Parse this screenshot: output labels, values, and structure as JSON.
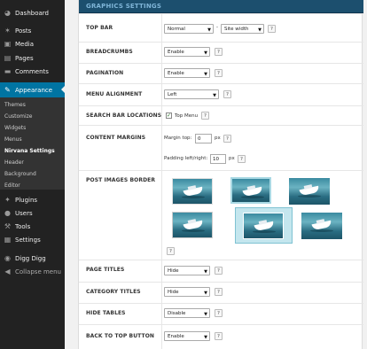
{
  "sidebar": {
    "items": [
      {
        "label": "Dashboard",
        "icon": "dashboard-icon",
        "glyph": "◕"
      },
      {
        "label": "Posts",
        "icon": "pin-icon",
        "glyph": "✶"
      },
      {
        "label": "Media",
        "icon": "media-icon",
        "glyph": "▣"
      },
      {
        "label": "Pages",
        "icon": "pages-icon",
        "glyph": "▤"
      },
      {
        "label": "Comments",
        "icon": "comments-icon",
        "glyph": "▬"
      },
      {
        "label": "Appearance",
        "icon": "paintbrush-icon",
        "glyph": "✎"
      },
      {
        "label": "Plugins",
        "icon": "plugin-icon",
        "glyph": "✦"
      },
      {
        "label": "Users",
        "icon": "users-icon",
        "glyph": "●"
      },
      {
        "label": "Tools",
        "icon": "wrench-icon",
        "glyph": "⚒"
      },
      {
        "label": "Settings",
        "icon": "settings-icon",
        "glyph": "▦"
      },
      {
        "label": "Digg Digg",
        "icon": "digg-icon",
        "glyph": "◉"
      },
      {
        "label": "Collapse menu",
        "icon": "collapse-icon",
        "glyph": "◀"
      }
    ],
    "submenu": [
      "Themes",
      "Customize",
      "Widgets",
      "Menus",
      "Nirvana Settings",
      "Header",
      "Background",
      "Editor"
    ],
    "submenu_current": "Nirvana Settings"
  },
  "panel": {
    "title": "GRAPHICS SETTINGS",
    "help": "?",
    "rows": {
      "topbar": {
        "label": "TOP BAR",
        "select1": "Normal",
        "dash": "-",
        "select2": "Site width"
      },
      "breadcrumbs": {
        "label": "BREADCRUMBS",
        "value": "Enable"
      },
      "pagination": {
        "label": "PAGINATION",
        "value": "Enable"
      },
      "menu_alignment": {
        "label": "MENU ALIGNMENT",
        "value": "Left"
      },
      "search_bar": {
        "label": "SEARCH BAR LOCATIONS",
        "option": "Top Menu",
        "checked": true
      },
      "content_margins": {
        "label": "CONTENT MARGINS",
        "top_label": "Margin top:",
        "top_value": "0",
        "side_label": "Padding left/right:",
        "side_value": "10",
        "unit": "px"
      },
      "post_images_border": {
        "label": "POST IMAGES BORDER",
        "styles": [
          "style-1",
          "style-2",
          "style-3",
          "style-4",
          "style-5",
          "style-6"
        ],
        "selected_index": 4
      },
      "page_titles": {
        "label": "PAGE TITLES",
        "value": "Hide"
      },
      "category_titles": {
        "label": "CATEGORY TITLES",
        "value": "Hide"
      },
      "hide_tables": {
        "label": "HIDE TABLES",
        "value": "Disable"
      },
      "back_to_top": {
        "label": "BACK TO TOP BUTTON",
        "value": "Enable"
      }
    }
  },
  "colors": {
    "admin_bar": "#222222",
    "active": "#0074a2",
    "header": "#1c4f6e",
    "header_text": "#7fb5d8"
  }
}
